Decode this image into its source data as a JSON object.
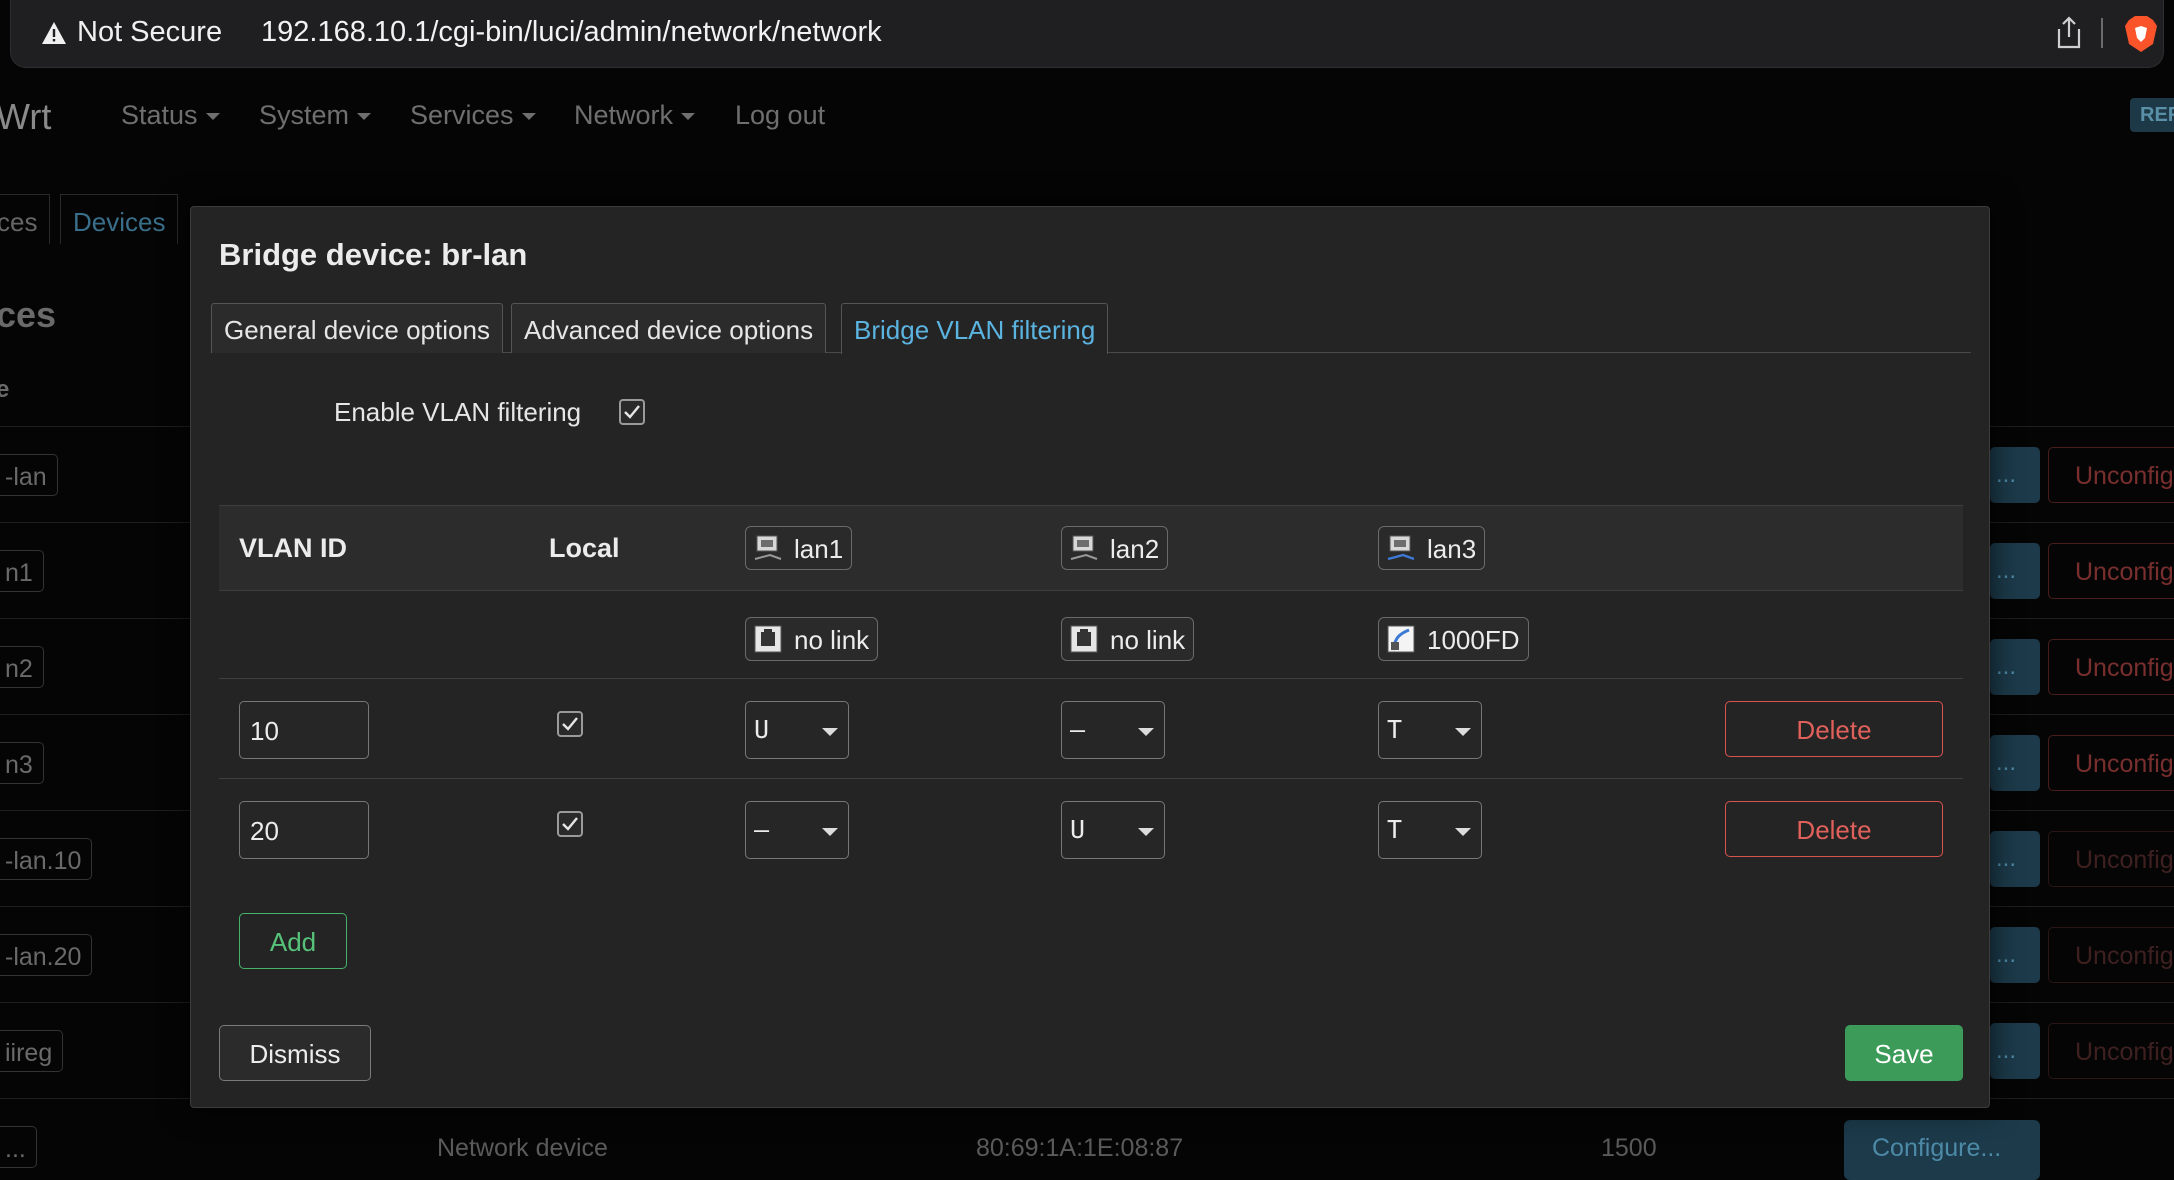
{
  "browser": {
    "security_label": "Not Secure",
    "url": "192.168.10.1/cgi-bin/luci/admin/network/network"
  },
  "background": {
    "brand": "Wrt",
    "nav": [
      "Status",
      "System",
      "Services",
      "Network",
      "Log out"
    ],
    "badge": "REF",
    "tabs": [
      "ces",
      "Devices"
    ],
    "heading": "ces",
    "column_head": "e",
    "devices": [
      "-lan",
      "n1",
      "n2",
      "n3",
      "-lan.10",
      "-lan.20",
      "iireg",
      "..."
    ],
    "configure_label": "...",
    "unconfigure_label": "Unconfig",
    "bottom_row": {
      "type": "Network device",
      "mac": "80:69:1A:1E:08:87",
      "mtu": "1500",
      "configure": "Configure..."
    }
  },
  "modal": {
    "title": "Bridge device: br-lan",
    "tabs": [
      {
        "label": "General device options"
      },
      {
        "label": "Advanced device options"
      },
      {
        "label": "Bridge VLAN filtering"
      }
    ],
    "vlan_filtering": {
      "label": "Enable VLAN filtering",
      "checked": true
    },
    "table": {
      "headers": {
        "vlan_id": "VLAN ID",
        "local": "Local"
      },
      "ports": [
        {
          "name": "lan1",
          "status": "no link"
        },
        {
          "name": "lan2",
          "status": "no link"
        },
        {
          "name": "lan3",
          "status": "1000FD"
        }
      ],
      "rows": [
        {
          "vlan_id": "10",
          "local": true,
          "lan1": "U",
          "lan2": "–",
          "lan3": "T",
          "delete": "Delete"
        },
        {
          "vlan_id": "20",
          "local": true,
          "lan1": "–",
          "lan2": "U",
          "lan3": "T",
          "delete": "Delete"
        }
      ]
    },
    "add_label": "Add",
    "dismiss_label": "Dismiss",
    "save_label": "Save"
  },
  "colors": {
    "accent": "#5bb3e0",
    "save": "#3c9b58",
    "delete": "#d9534f",
    "add": "#47b36a"
  }
}
